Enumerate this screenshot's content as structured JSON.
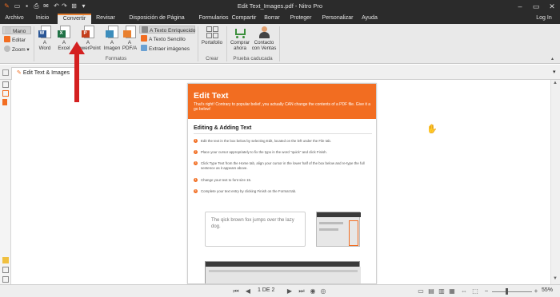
{
  "window": {
    "title": "Edit Text_Images.pdf - Nitro Pro",
    "user": "Log In"
  },
  "tabs": [
    "Archivo",
    "Inicio",
    "Convertir",
    "Revisar",
    "Disposición de Página",
    "Formularios",
    "Compartir",
    "Borrar",
    "Proteger",
    "Personalizar",
    "Ayuda"
  ],
  "active_tab": "Convertir",
  "ribbon": {
    "tools": {
      "hand": "Mano",
      "edit": "Editar",
      "zoom": "Zoom"
    },
    "convert_buttons": [
      {
        "line1": "A",
        "line2": "Word",
        "badge": "W",
        "color": "#2b5797"
      },
      {
        "line1": "A",
        "line2": "Excel",
        "badge": "X",
        "color": "#1f7145"
      },
      {
        "line1": "A",
        "line2": "PowerPoint",
        "badge": "P",
        "color": "#c43e1c"
      },
      {
        "line1": "A",
        "line2": "Imagen",
        "badge": "",
        "color": "#3c8dbc"
      },
      {
        "line1": "A",
        "line2": "PDF/A",
        "badge": "",
        "color": "#e9802f"
      }
    ],
    "text_options": [
      "A Texto Enriquecido",
      "A Texto Sencillo",
      "Extraer imágenes"
    ],
    "formats_group": "Formatos",
    "portfolio": "Portafolio",
    "create_group": "Crear",
    "buy": [
      "Comprar",
      "ahora"
    ],
    "contact": [
      "Contacto",
      "con Ventas"
    ],
    "trial_group": "Prueba caducada"
  },
  "document_tab": "Edit Text & Images",
  "page": {
    "title": "Edit Text",
    "intro": "That's right! Contrary to popular belief, you actually CAN change the contents of a PDF file. Give it a go below!",
    "heading": "Editing & Adding Text",
    "steps": [
      "Edit the text in the box below by selecting Edit, located on the left under the File tab.",
      "Place your cursor appropriately to fix the typo in the word \"quick\" and click Finish.",
      "Click Type Text from the Home tab, align your cursor in the lower half of the box below and re-type the full sentence as it appears above.",
      "Change your text to font size 15.",
      "Complete your text entry by clicking Finish on the Format tab."
    ],
    "sample_text": "The qick brown fox jumps over the lazy dog."
  },
  "status": {
    "page_indicator": "1 DE 2",
    "zoom": "55%"
  },
  "colors": {
    "accent": "#f26d21",
    "arrow": "#d42020"
  }
}
